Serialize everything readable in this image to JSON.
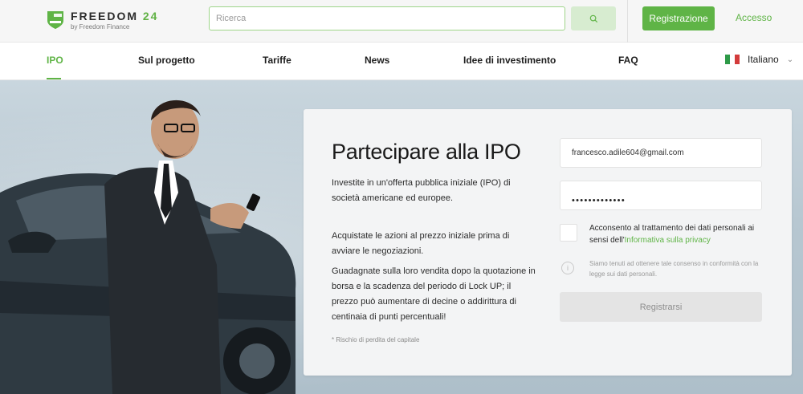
{
  "header": {
    "logo_title": "FREEDOM",
    "logo_number": "24",
    "logo_subtitle": "by Freedom Finance",
    "search_placeholder": "Ricerca",
    "register_label": "Registrazione",
    "login_label": "Accesso"
  },
  "nav": {
    "items": [
      {
        "label": "IPO",
        "active": true
      },
      {
        "label": "Sul progetto"
      },
      {
        "label": "Tariffe"
      },
      {
        "label": "News"
      },
      {
        "label": "Idee di investimento"
      },
      {
        "label": "FAQ"
      }
    ],
    "language": "Italiano"
  },
  "hero": {
    "title": "Partecipare alla IPO",
    "paragraphs": [
      "Investite in un'offerta pubblica iniziale (IPO) di società americane ed europee.",
      "Acquistate le azioni al prezzo iniziale prima di avviare le negoziazioni.",
      "Guadagnate sulla loro vendita dopo la quotazione in borsa e la scadenza del periodo di Lock UP; il prezzo può aumentare di decine o addirittura di centinaia di punti percentuali!"
    ],
    "footnote": "* Rischio di perdita del capitale"
  },
  "form": {
    "email_value": "francesco.adile604@gmail.com",
    "password_masked": "•••••••••••••",
    "consent_text": "Acconsento al trattamento dei dati personali ai sensi dell'",
    "consent_link": "Informativa sulla privacy",
    "info_text": "Siamo tenuti ad ottenere tale consenso in conformità con la legge sui dati personali.",
    "submit_label": "Registrarsi"
  },
  "colors": {
    "accent": "#5fb446",
    "search_border": "#9ed589"
  }
}
